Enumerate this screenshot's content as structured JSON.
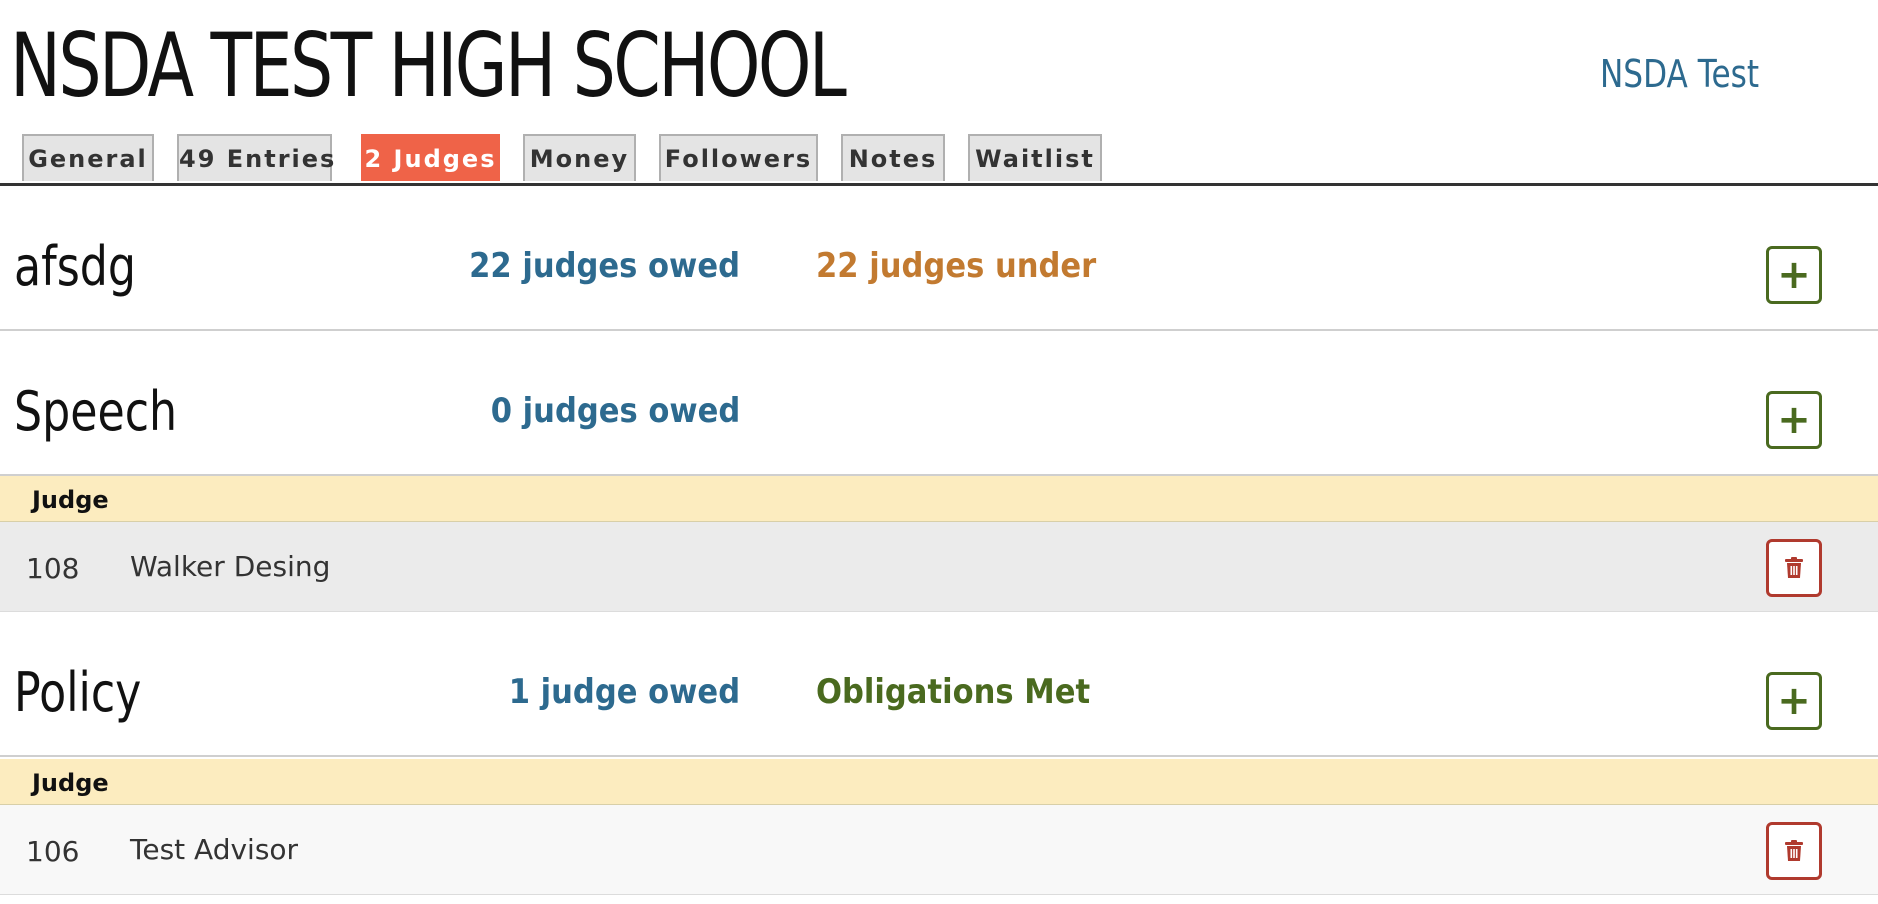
{
  "header": {
    "school_name": "NSDA TEST HIGH SCHOOL",
    "account_link": "NSDA Test"
  },
  "tabs": [
    {
      "label": "General",
      "active": false
    },
    {
      "label": "49 Entries",
      "active": false
    },
    {
      "label": "2 Judges",
      "active": true
    },
    {
      "label": "Money",
      "active": false
    },
    {
      "label": "Followers",
      "active": false
    },
    {
      "label": "Notes",
      "active": false
    },
    {
      "label": "Waitlist",
      "active": false
    }
  ],
  "colors": {
    "active_tab": "#ef6348",
    "owed_text": "#2d6a8f",
    "under_text": "#c27a30",
    "met_text": "#4a6a1f",
    "add_button": "#4a6a1f",
    "delete_button": "#b03a2e",
    "column_header_bg": "#fcecbf"
  },
  "sections": [
    {
      "name": "afsdg",
      "owed": "22 judges owed",
      "status": "22 judges under",
      "add_icon": "plus-icon"
    },
    {
      "name": "Speech",
      "owed": "0 judges owed",
      "add_icon": "plus-icon",
      "column_header": "Judge",
      "judges": [
        {
          "code": "108",
          "name": "Walker Desing",
          "delete_icon": "trash-icon"
        }
      ]
    },
    {
      "name": "Policy",
      "owed": "1 judge owed",
      "status": "Obligations Met",
      "add_icon": "plus-icon",
      "column_header": "Judge",
      "judges": [
        {
          "code": "106",
          "name": "Test Advisor",
          "delete_icon": "trash-icon"
        }
      ]
    }
  ]
}
